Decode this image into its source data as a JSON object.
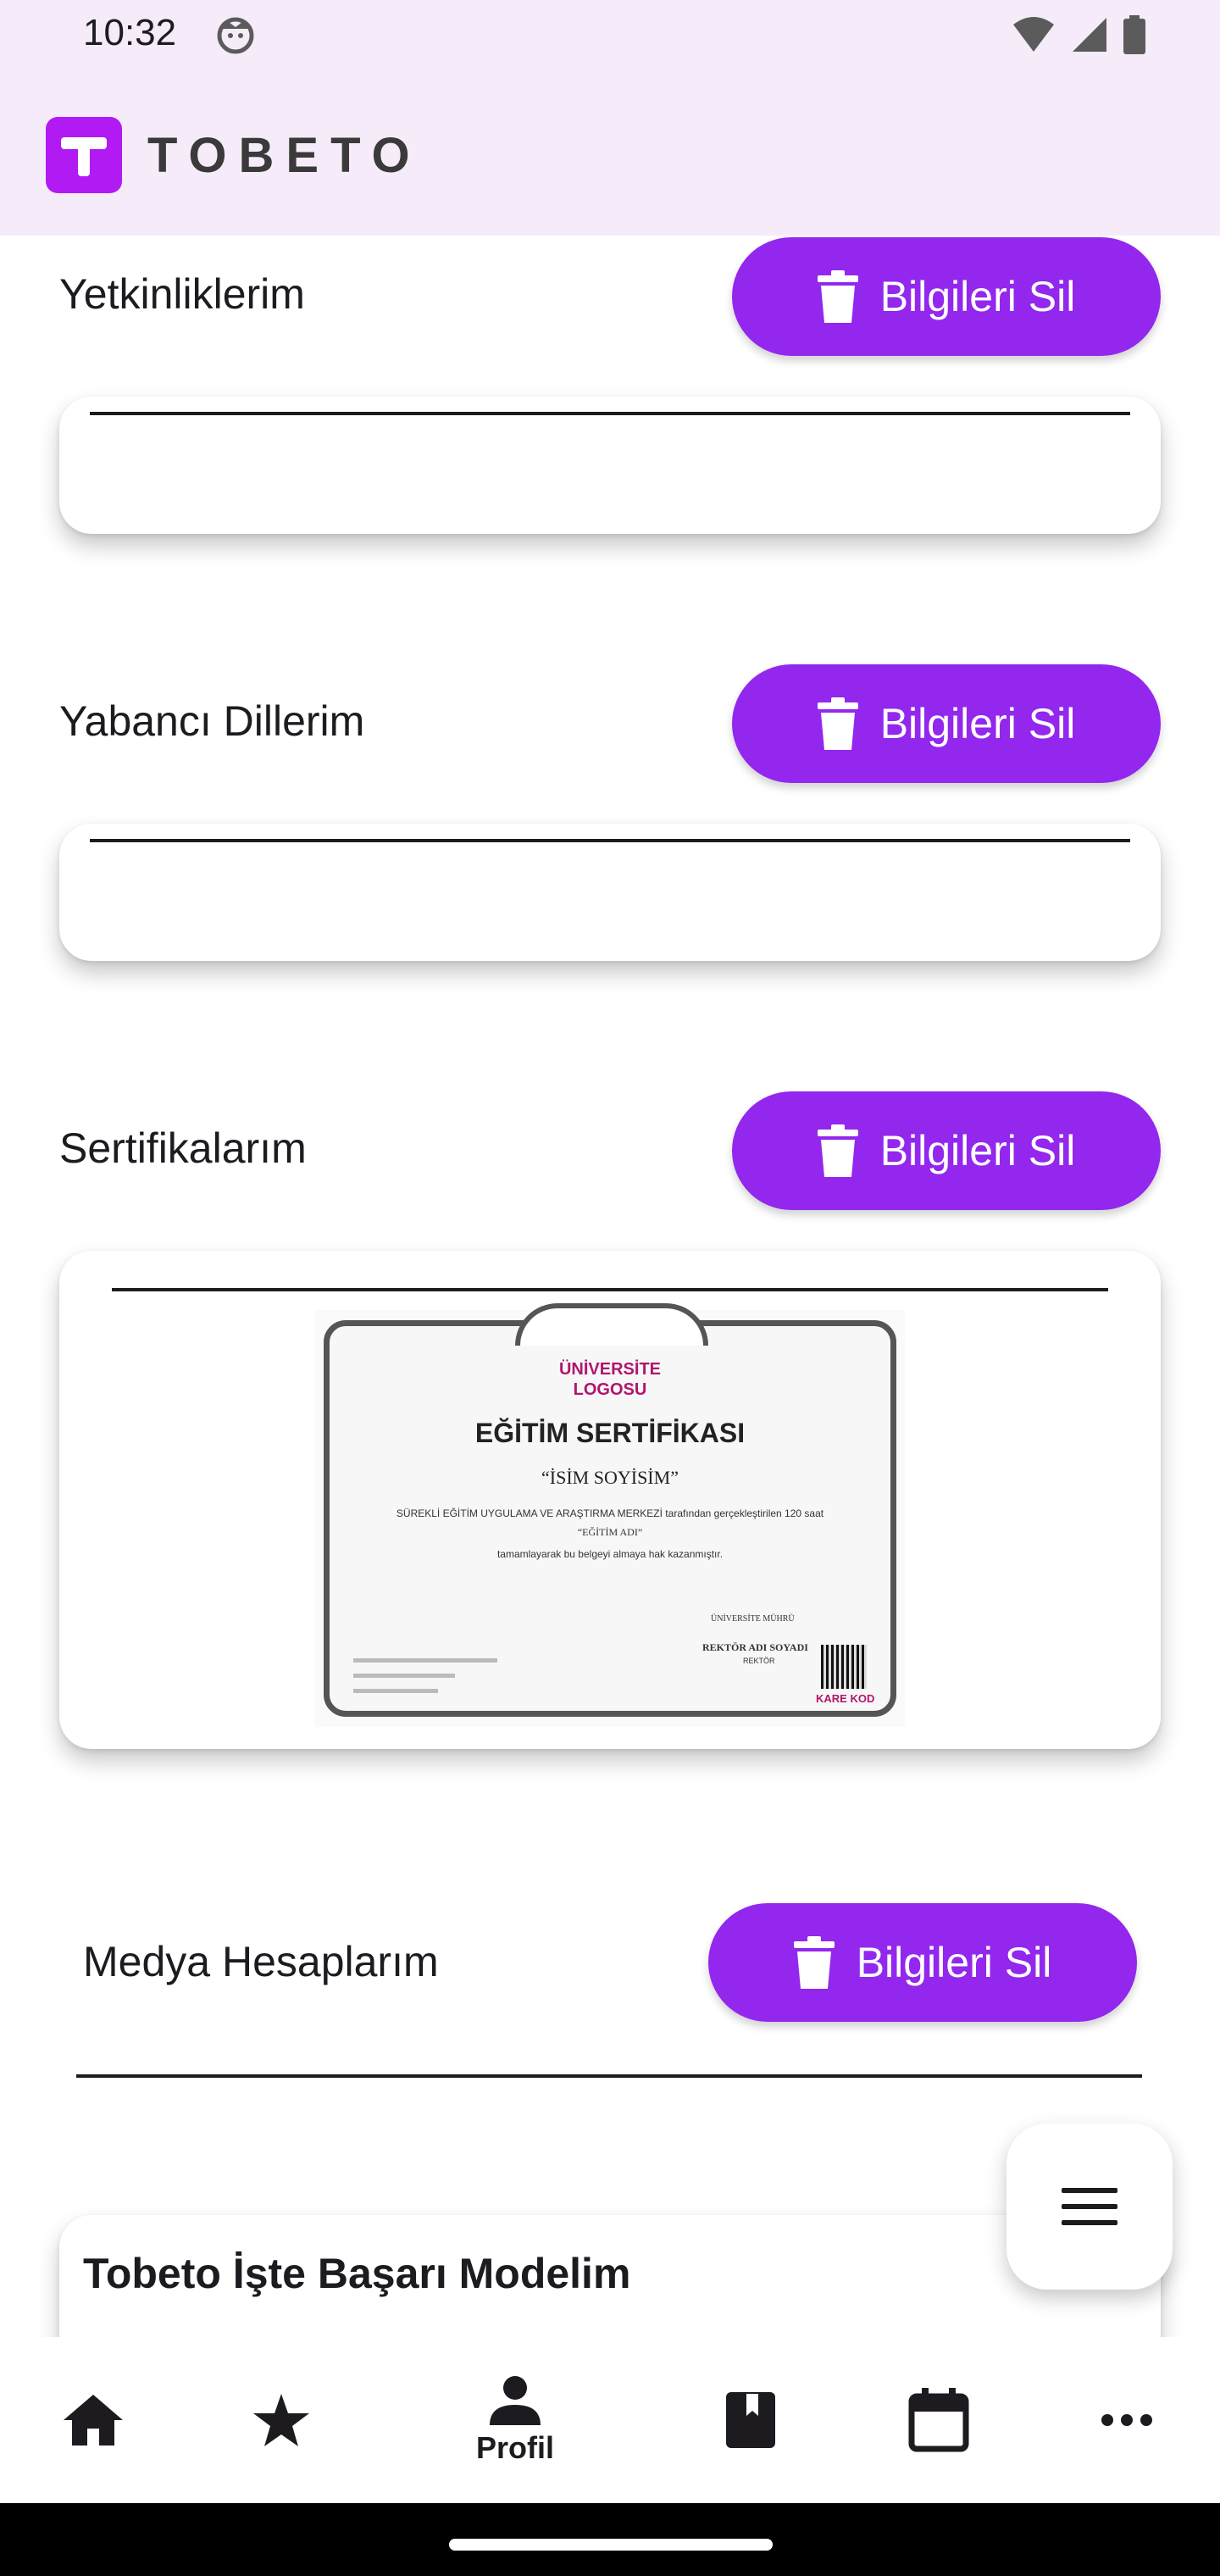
{
  "status": {
    "time": "10:32"
  },
  "app": {
    "brand": "TOBETO"
  },
  "sections": [
    {
      "title": "Yetkinliklerim",
      "button": "Bilgileri Sil"
    },
    {
      "title": "Yabancı Dillerim",
      "button": "Bilgileri Sil"
    },
    {
      "title": "Sertifikalarım",
      "button": "Bilgileri Sil"
    },
    {
      "title": "Medya Hesaplarım",
      "button": "Bilgileri Sil"
    },
    {
      "title": "Tobeto İşte Başarı Modelim"
    }
  ],
  "certificate": {
    "logo_line1": "ÜNİVERSİTE",
    "logo_line2": "LOGOSU",
    "heading": "EĞİTİM SERTİFİKASI",
    "name": "“İSİM SOYİSİM”",
    "body1": "SÜREKLİ EĞİTİM UYGULAMA VE ARAŞTIRMA MERKEZİ tarafından gerçekleştirilen 120 saat",
    "body2": "“EĞİTİM ADI”",
    "body3": "tamamlayarak bu belgeyi almaya hak kazanmıştır.",
    "seal": "ÜNİVERSİTE MÜHRÜ",
    "rector": "REKTÖR ADI SOYADI",
    "rector_title": "REKTÖR",
    "qr_label": "KARE KOD"
  },
  "bottom_nav": [
    {
      "icon": "home-icon",
      "label": ""
    },
    {
      "icon": "star-icon",
      "label": ""
    },
    {
      "icon": "person-icon",
      "label": "Profil"
    },
    {
      "icon": "book-icon",
      "label": ""
    },
    {
      "icon": "calendar-icon",
      "label": ""
    },
    {
      "icon": "more-icon",
      "label": ""
    }
  ],
  "colors": {
    "accent": "#9327ee",
    "appbar": "#f6ebf9",
    "logo": "#b21af3"
  }
}
